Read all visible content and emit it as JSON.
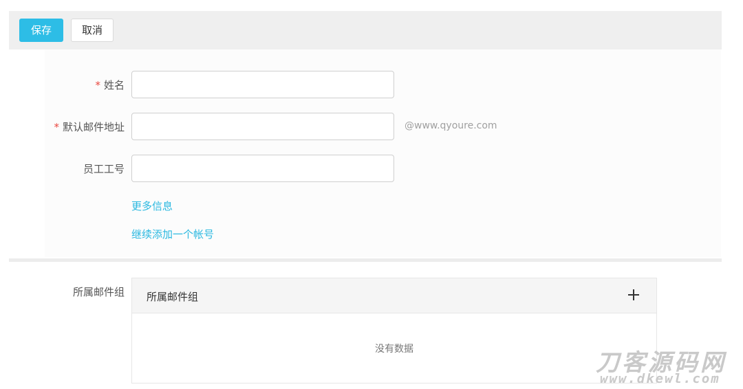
{
  "toolbar": {
    "save_label": "保存",
    "cancel_label": "取消"
  },
  "form": {
    "required_mark": "*",
    "name": {
      "label": "姓名",
      "value": "",
      "placeholder": ""
    },
    "email": {
      "label": "默认邮件地址",
      "value": "",
      "placeholder": "",
      "suffix": "@www.qyoure.com"
    },
    "employee_id": {
      "label": "员工工号",
      "value": "",
      "placeholder": ""
    },
    "more_info_link": "更多信息",
    "add_another_link": "继续添加一个帐号"
  },
  "mail_groups": {
    "label": "所属邮件组",
    "panel_title": "所属邮件组",
    "add_icon": "plus-icon",
    "empty_text": "没有数据"
  },
  "watermark": {
    "cn": "刀客源码网",
    "en": "www.dkewl.com"
  },
  "colors": {
    "primary": "#2dbde6",
    "link": "#2ab8e0",
    "required": "#e9473f"
  }
}
